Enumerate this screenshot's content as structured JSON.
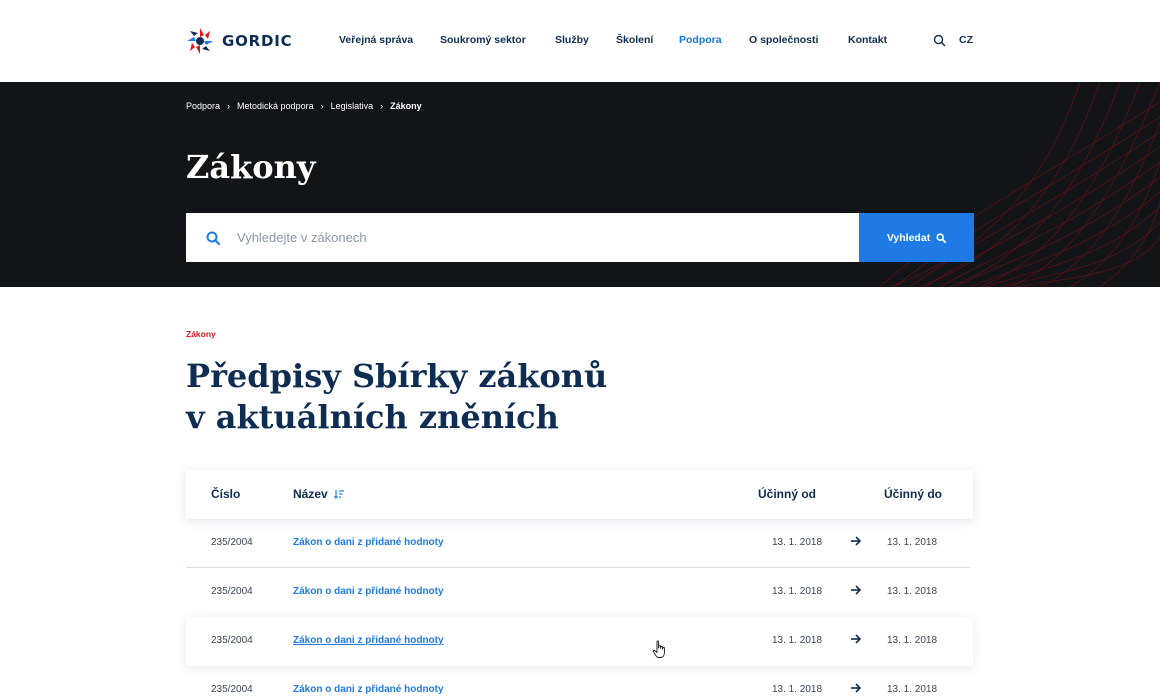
{
  "brand": {
    "name": "GORDIC"
  },
  "nav": {
    "items": [
      {
        "label": "Veřejná správa",
        "active": false
      },
      {
        "label": "Soukromý sektor",
        "active": false
      },
      {
        "label": "Služby",
        "active": false
      },
      {
        "label": "Školení",
        "active": false
      },
      {
        "label": "Podpora",
        "active": true
      },
      {
        "label": "O společnosti",
        "active": false
      },
      {
        "label": "Kontakt",
        "active": false
      }
    ],
    "search_icon": "search-icon",
    "language": "CZ"
  },
  "breadcrumb": {
    "items": [
      "Podpora",
      "Metodická podpora",
      "Legislativa"
    ],
    "current": "Zákony",
    "separator": "›"
  },
  "hero": {
    "title": "Zákony",
    "search_placeholder": "Vyhledejte v zákonech",
    "search_button": "Vyhledat"
  },
  "section": {
    "kicker": "Zákony",
    "title_line1": "Předpisy Sbírky zákonů",
    "title_line2": "v aktuálních zněních"
  },
  "table": {
    "headers": {
      "number": "Číslo",
      "name": "Název",
      "from": "Účinný od",
      "to": "Účinný do"
    },
    "rows": [
      {
        "number": "235/2004",
        "name": "Zákon o dani z přidané hodnoty",
        "from": "13. 1. 2018",
        "to": "13. 1. 2018"
      },
      {
        "number": "235/2004",
        "name": "Zákon o dani z přidané hodnoty",
        "from": "13. 1. 2018",
        "to": "13. 1. 2018"
      },
      {
        "number": "235/2004",
        "name": "Zákon o dani z přidané hodnoty",
        "from": "13. 1. 2018",
        "to": "13. 1. 2018"
      },
      {
        "number": "235/2004",
        "name": "Zákon o dani z přidané hodnoty",
        "from": "13. 1. 2018",
        "to": "13. 1. 2018"
      }
    ]
  },
  "colors": {
    "navy": "#0f2d52",
    "accent_blue": "#1e7be6",
    "kicker_red": "#e0161d",
    "hero_bg": "#131418"
  }
}
